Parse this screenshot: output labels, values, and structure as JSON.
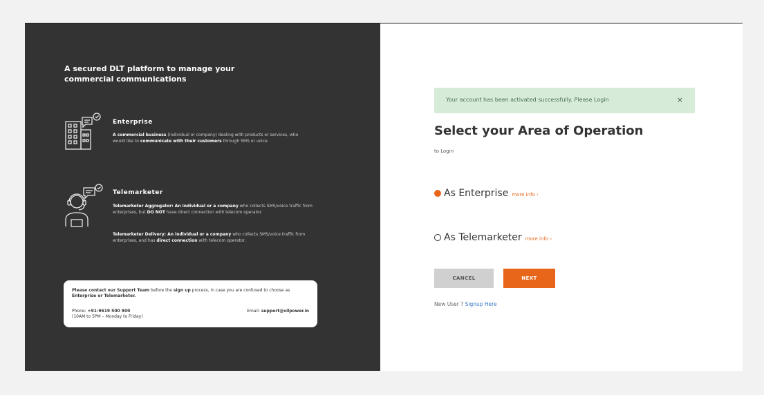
{
  "left": {
    "tagline": "A secured DLT platform to manage your commercial communications",
    "enterprise": {
      "title": "Enterprise",
      "desc_bold1": "A commercial business",
      "desc_text1": " (individual or company) dealing with products or services, who would like to ",
      "desc_bold2": "communicate with their customers",
      "desc_text2": " through SMS or voice."
    },
    "telemarketer": {
      "title": "Telemarketer",
      "agg_bold": "Telemarketer Aggregator: An individual or a company",
      "agg_text1": " who collects SMS/voice traffic from enterprises, but ",
      "agg_bold2": "DO NOT",
      "agg_text2": " have direct connection with telecom operator.",
      "del_bold": "Telemarketer Delivery: An individual or a company",
      "del_text1": " who collects SMS/voice traffic from enterprises, and has ",
      "del_bold2": "direct connection",
      "del_text2": " with  telecom operator."
    },
    "support": {
      "text_bold1": "Please contact our Support Team",
      "text1": " before the ",
      "text_bold2": "sign up",
      "text2": " process, in case you are confused to choose as ",
      "text_bold3": "Enterprise or Telemarketer.",
      "phone_label": "Phone: ",
      "phone": "+91-9619 500 900",
      "hours": "(10AM to 5PM – Monday to Friday)",
      "email_label": "Email: ",
      "email": "support@vilpower.in"
    }
  },
  "right": {
    "alert": "Your account has been activated successfully. Please Login",
    "alert_close": "×",
    "heading": "Select your Area of Operation",
    "subheading": "to Login",
    "option_enterprise": "As Enterprise",
    "option_telemarketer": "As Telemarketer",
    "more_info": "more info ›",
    "cancel": "CANCEL",
    "next": "NEXT",
    "new_user": "New User ? ",
    "signup": "Signup Here"
  },
  "colors": {
    "accent": "#e8661a",
    "dark_panel": "#333333",
    "alert_bg": "#d6ecd9",
    "link": "#3a78c9"
  },
  "icons": {
    "enterprise": "building-chat-icon",
    "telemarketer": "headset-agent-icon"
  }
}
